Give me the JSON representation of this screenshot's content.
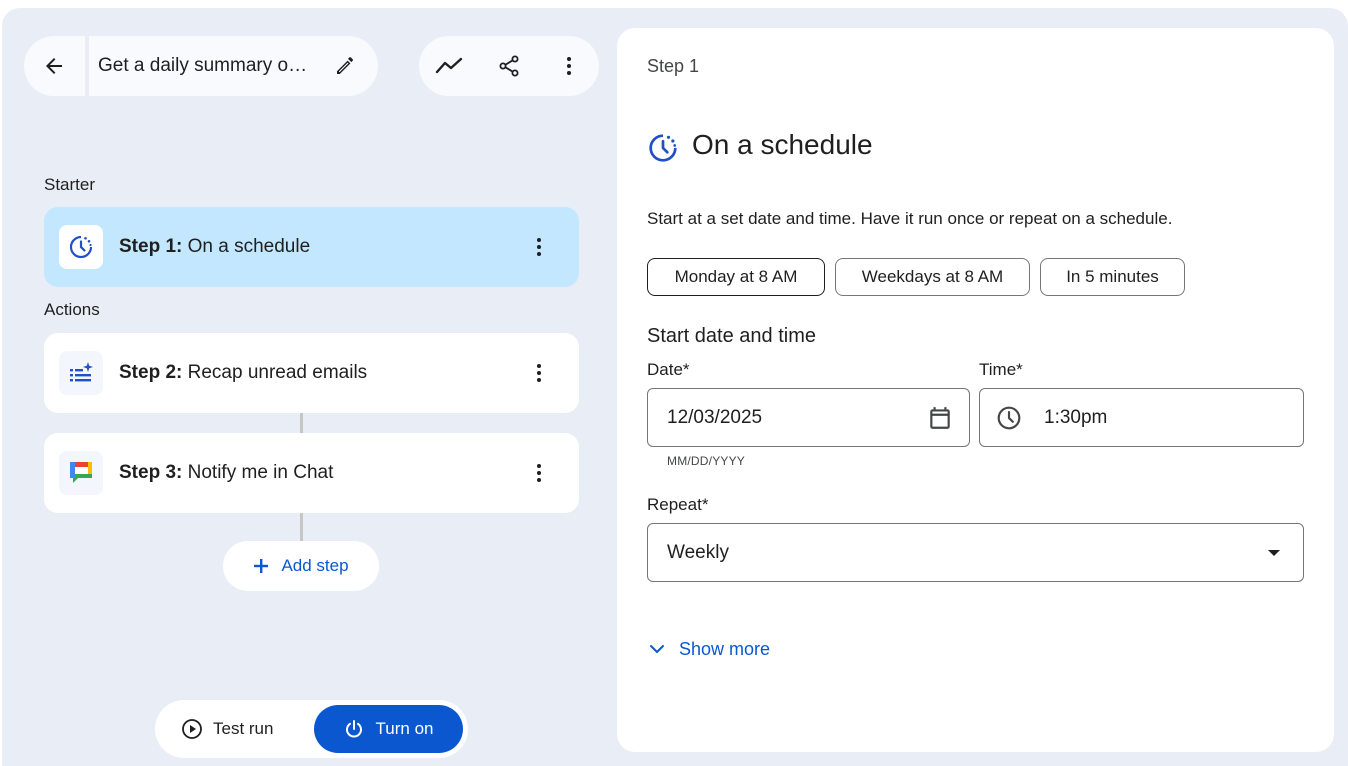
{
  "header": {
    "title": "Get a daily summary o…",
    "icons": [
      "arrow-back-icon",
      "edit-pencil-icon",
      "activity-icon",
      "share-icon",
      "more-vert-icon"
    ]
  },
  "sidebar": {
    "starter_label": "Starter",
    "actions_label": "Actions",
    "steps": [
      {
        "num": "Step 1:",
        "label": "On a schedule",
        "icon": "schedule-icon",
        "active": true
      },
      {
        "num": "Step 2:",
        "label": "Recap unread emails",
        "icon": "list-sparkle-icon",
        "active": false
      },
      {
        "num": "Step 3:",
        "label": "Notify me in Chat",
        "icon": "google-chat-icon",
        "active": false
      }
    ],
    "add_step_label": "Add step",
    "test_run_label": "Test run",
    "turn_on_label": "Turn on"
  },
  "panel": {
    "step_label": "Step 1",
    "title": "On a schedule",
    "description": "Start at a set date and time. Have it run once or repeat on a schedule.",
    "chips": [
      "Monday at 8 AM",
      "Weekdays at 8 AM",
      "In 5 minutes"
    ],
    "section_title": "Start date and time",
    "date": {
      "label": "Date*",
      "value": "12/03/2025",
      "helper": "MM/DD/YYYY"
    },
    "time": {
      "label": "Time*",
      "value": "1:30pm"
    },
    "repeat": {
      "label": "Repeat*",
      "value": "Weekly"
    },
    "show_more_label": "Show more"
  },
  "colors": {
    "accent": "#0b57d0",
    "active_step_bg": "#c2e7ff",
    "app_bg": "#e9eef6"
  }
}
